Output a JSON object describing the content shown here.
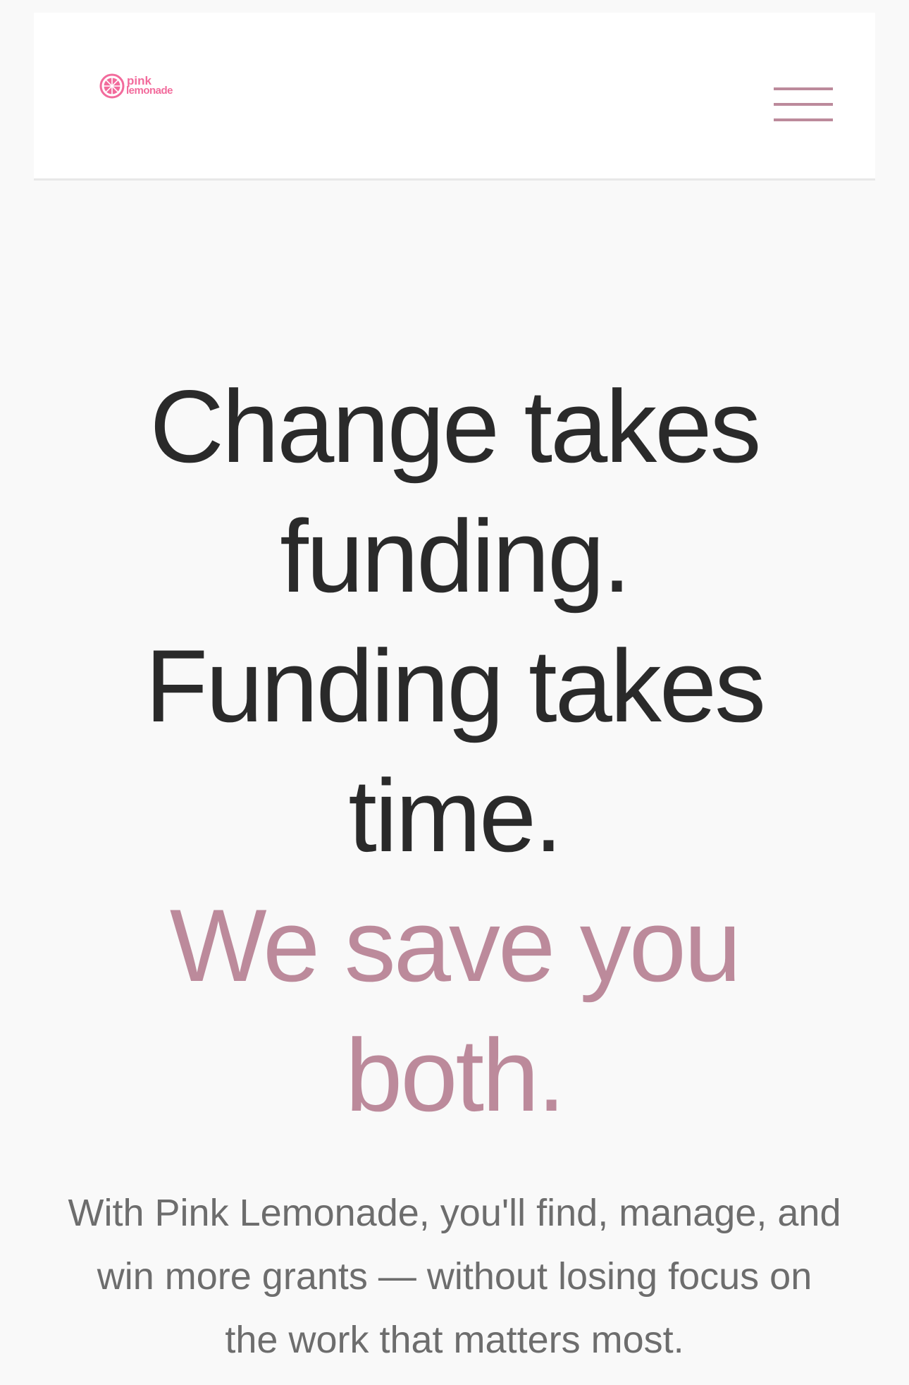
{
  "header": {
    "logo": {
      "word_1": "pink",
      "word_2": "lemonade",
      "icon": "lemon-slice-icon",
      "color": "#f26b9c"
    },
    "menu_icon": "hamburger-menu-icon",
    "menu_color": "#bc8a9b"
  },
  "hero": {
    "title_lines": [
      "Change takes",
      "funding.",
      "Funding takes",
      "time."
    ],
    "accent_lines": [
      "We save you",
      "both."
    ],
    "accent_color": "#bc8a9b",
    "subtitle": "With Pink Lemonade, you'll find, manage, and win more grants — without losing focus on the work that matters most."
  }
}
